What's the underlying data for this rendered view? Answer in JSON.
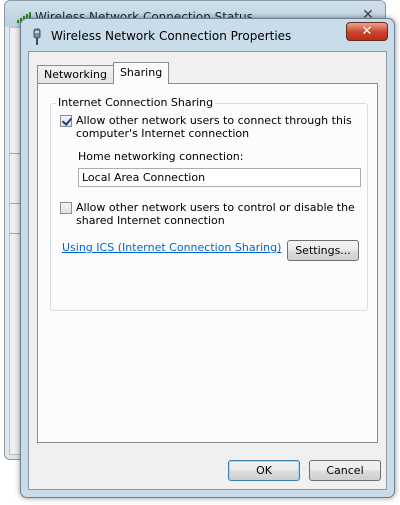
{
  "background_window": {
    "title": "Wireless Network Connection Status",
    "close_glyph": "✕"
  },
  "dialog": {
    "title": "Wireless Network Connection Properties",
    "close_glyph": "✕",
    "icon": "network-adapter-icon"
  },
  "tabs": [
    {
      "label": "Networking",
      "active": false
    },
    {
      "label": "Sharing",
      "active": true
    }
  ],
  "sharing": {
    "group_title": "Internet Connection Sharing",
    "allow_connect": {
      "checked": true,
      "label_line1": "Allow other network users to connect through this",
      "label_line2": "computer's Internet connection"
    },
    "home_connection_label": "Home networking connection:",
    "home_connection_value": "Local Area Connection",
    "allow_control": {
      "checked": false,
      "label_line1": "Allow other network users to control or disable the",
      "label_line2": "shared Internet connection"
    },
    "ics_link": "Using ICS (Internet Connection Sharing)",
    "settings_button": "Settings..."
  },
  "footer": {
    "ok_button": "OK",
    "cancel_button": "Cancel"
  },
  "colors": {
    "link": "#0066cc",
    "close_button": "#c8432a",
    "frame": "#c9dcea"
  }
}
